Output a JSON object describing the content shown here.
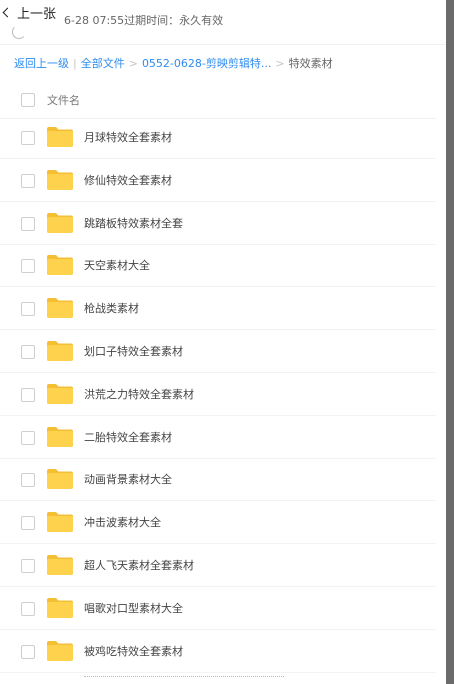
{
  "top": {
    "back_label": "上一张",
    "expire_text": "6-28 07:55过期时间：永久有效"
  },
  "breadcrumb": {
    "items": [
      "返回上一级",
      "全部文件",
      "0552-0628-剪映剪辑特..."
    ],
    "current": "特效素材",
    "separator_pipe": "|",
    "separator_arrow": ">"
  },
  "list": {
    "header_label": "文件名",
    "folder_color": "#ffd24d",
    "folder_back_color": "#f5bf35",
    "rows": [
      {
        "name": "月球特效全套素材"
      },
      {
        "name": "修仙特效全套素材"
      },
      {
        "name": "跳踏板特效素材全套"
      },
      {
        "name": "天空素材大全"
      },
      {
        "name": "枪战类素材"
      },
      {
        "name": "划口子特效全套素材"
      },
      {
        "name": "洪荒之力特效全套素材"
      },
      {
        "name": "二胎特效全套素材"
      },
      {
        "name": "动画背景素材大全"
      },
      {
        "name": "冲击波素材大全"
      },
      {
        "name": "超人飞天素材全套素材"
      },
      {
        "name": "唱歌对口型素材大全"
      },
      {
        "name": "被鸡吃特效全套素材"
      }
    ]
  }
}
